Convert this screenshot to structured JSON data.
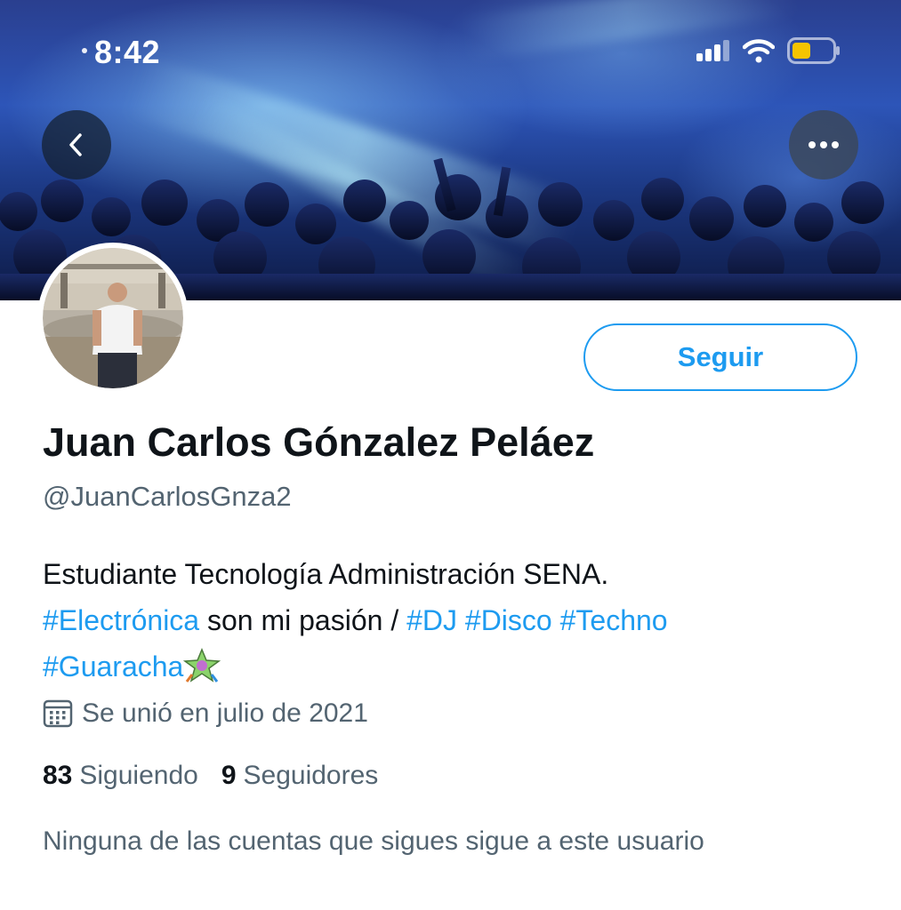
{
  "status_bar": {
    "time": "8:42",
    "signal_icon": "cellular-signal-icon",
    "wifi_icon": "wifi-icon",
    "battery_icon": "battery-low-icon",
    "battery_color": "#f5c400"
  },
  "header": {
    "back_icon": "chevron-left-icon",
    "more_icon": "ellipsis-icon"
  },
  "profile": {
    "follow_label": "Seguir",
    "name": "Juan Carlos Gónzalez Peláez",
    "handle": "@JuanCarlosGnza2",
    "bio": {
      "line1": "Estudiante Tecnología Administración SENA.",
      "tag_electronica": "#Electrónica",
      "text_pasion": " son mi pasión / ",
      "tag_dj": "#DJ",
      "tag_disco": "#Disco",
      "tag_techno": "#Techno",
      "tag_guaracha": "#Guaracha",
      "emoji_icon": "pinata-icon"
    },
    "joined_icon": "calendar-icon",
    "joined": "Se unió en julio de 2021",
    "following_count": "83",
    "following_label": "Siguiendo",
    "followers_count": "9",
    "followers_label": "Seguidores",
    "mutual_note": "Ninguna de las cuentas que sigues sigue a este usuario"
  },
  "colors": {
    "accent": "#1d9bf0",
    "text_primary": "#0f1419",
    "text_secondary": "#536471"
  }
}
